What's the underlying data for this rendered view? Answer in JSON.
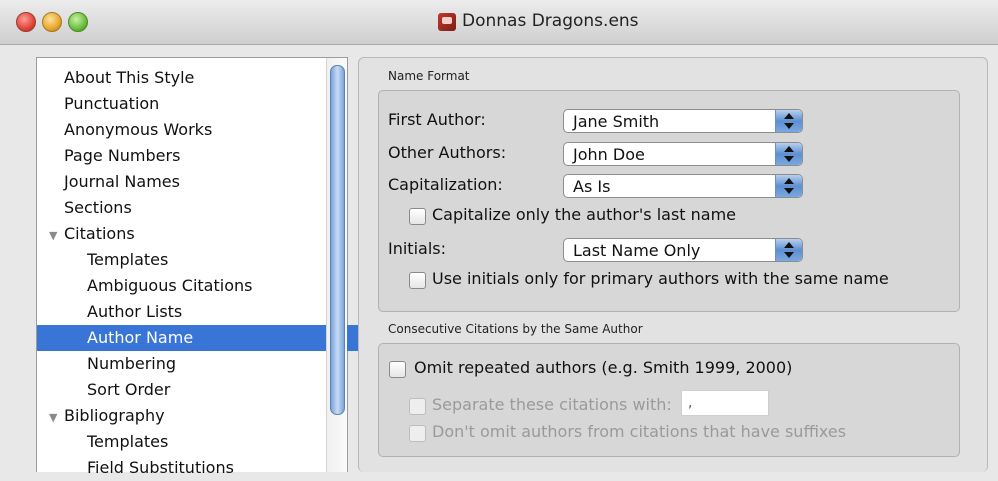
{
  "window": {
    "title": "Donnas Dragons.ens"
  },
  "sidebar": {
    "items": [
      {
        "label": "About This Style"
      },
      {
        "label": "Punctuation"
      },
      {
        "label": "Anonymous Works"
      },
      {
        "label": "Page Numbers"
      },
      {
        "label": "Journal Names"
      },
      {
        "label": "Sections"
      },
      {
        "label": "Citations",
        "expanded": true
      },
      {
        "label": "Templates"
      },
      {
        "label": "Ambiguous Citations"
      },
      {
        "label": "Author Lists"
      },
      {
        "label": "Author Name",
        "selected": true
      },
      {
        "label": "Numbering"
      },
      {
        "label": "Sort Order"
      },
      {
        "label": "Bibliography",
        "expanded": true
      },
      {
        "label": "Templates"
      },
      {
        "label": "Field Substitutions"
      }
    ]
  },
  "name_format": {
    "label": "Name Format",
    "first_author": {
      "label": "First Author:",
      "value": "Jane Smith"
    },
    "other_authors": {
      "label": "Other Authors:",
      "value": "John Doe"
    },
    "capitalization": {
      "label": "Capitalization:",
      "value": "As Is"
    },
    "capitalize_last_name": {
      "label": "Capitalize only the author's last name",
      "checked": false
    },
    "initials": {
      "label": "Initials:",
      "value": "Last Name Only"
    },
    "use_initials_primary": {
      "label": "Use initials only for primary authors with the same name",
      "checked": false
    }
  },
  "consecutive": {
    "label": "Consecutive Citations by the Same Author",
    "omit_repeated": {
      "label": "Omit repeated authors (e.g. Smith 1999, 2000)",
      "checked": false
    },
    "separate": {
      "label": "Separate these citations with:",
      "value": ",",
      "enabled": false
    },
    "dont_omit": {
      "label": "Don't omit authors from citations that have suffixes",
      "enabled": false
    }
  },
  "colors": {
    "selection": "#3875d7",
    "accent": "#5d8fd1"
  }
}
